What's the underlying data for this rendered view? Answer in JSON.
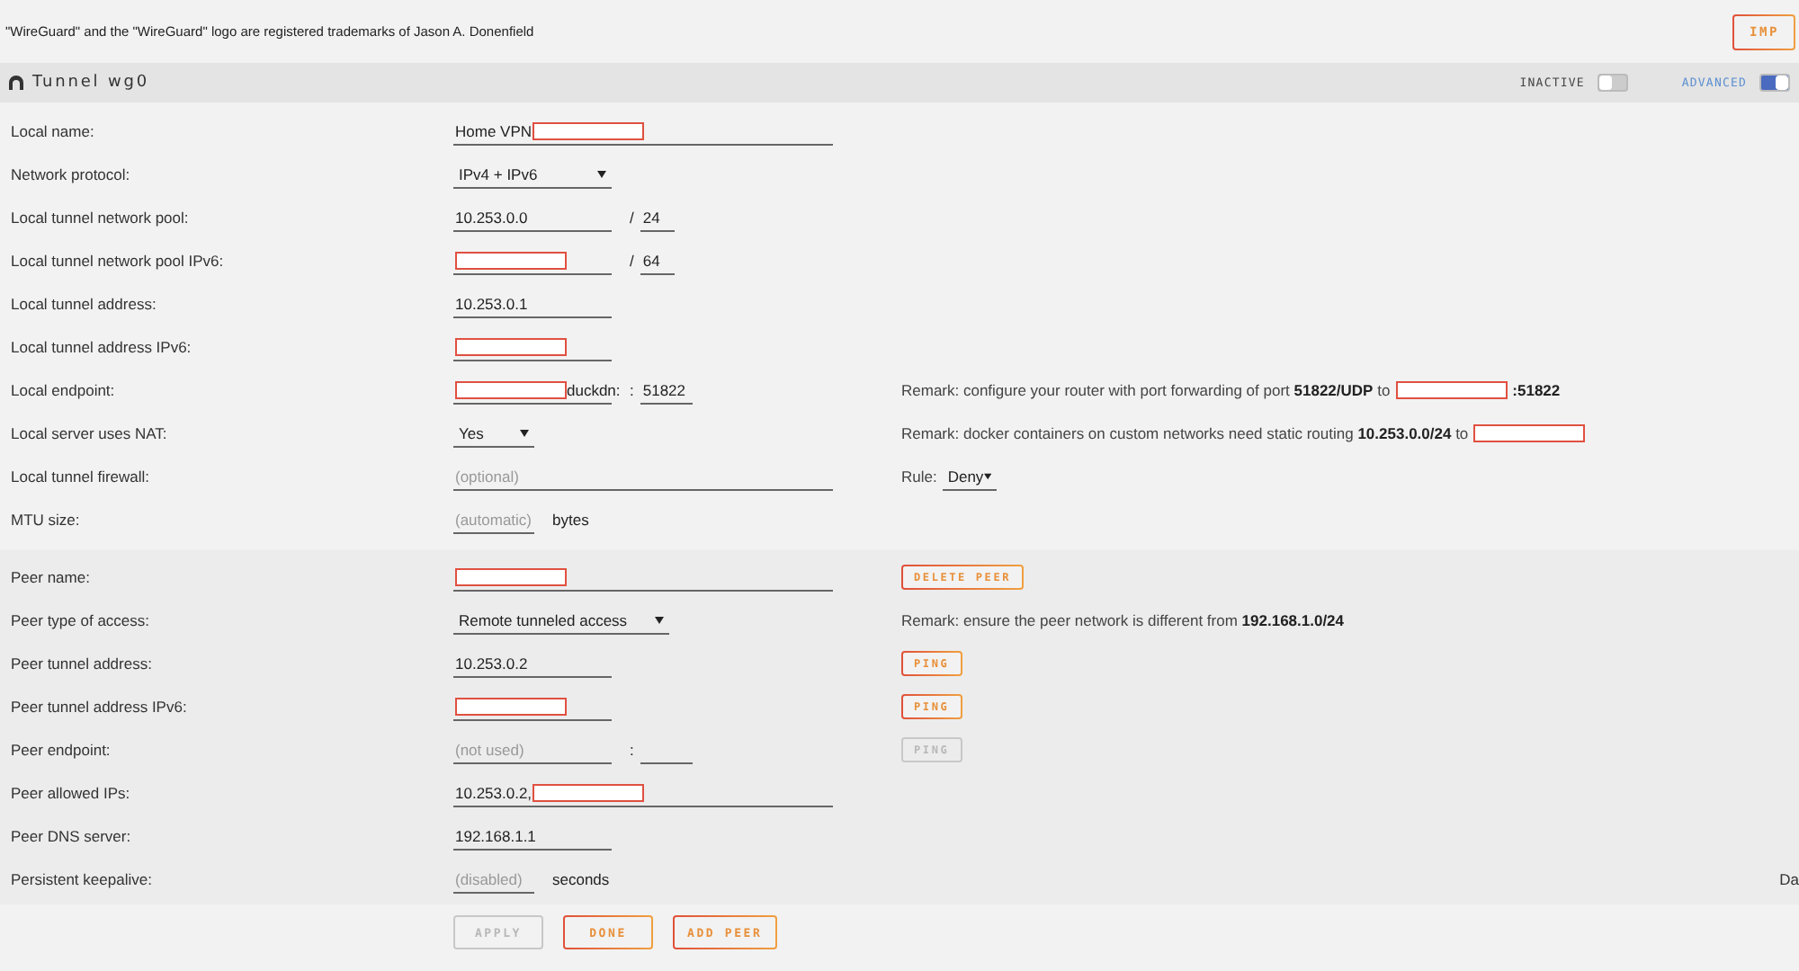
{
  "notice": "\"WireGuard\" and the \"WireGuard\" logo are registered trademarks of Jason A. Donenfield",
  "top_button": {
    "label": "IMP",
    "disabled": false
  },
  "tunnel": {
    "title": "Tunnel wg0",
    "toggles": [
      {
        "label": "INACTIVE",
        "on": false
      },
      {
        "label": "ADVANCED",
        "on": true
      }
    ]
  },
  "sections": [
    {
      "kind": "local",
      "rows": [
        {
          "label": "Local name:",
          "controls": [
            {
              "kind": "longfield",
              "value": "Home VPN",
              "redacted": true
            }
          ]
        },
        {
          "label": "Network protocol:",
          "controls": [
            {
              "kind": "select",
              "value": "IPv4 + IPv6"
            }
          ]
        },
        {
          "label": "Local tunnel network pool:",
          "controls": [
            {
              "kind": "field",
              "value": "10.253.0.0"
            },
            {
              "kind": "text",
              "text": "/"
            },
            {
              "kind": "tinyfield",
              "value": "24"
            }
          ]
        },
        {
          "label": "Local tunnel network pool IPv6:",
          "controls": [
            {
              "kind": "field",
              "redacted": true
            },
            {
              "kind": "text",
              "text": "/"
            },
            {
              "kind": "tinyfield",
              "value": "64"
            }
          ]
        },
        {
          "label": "Local tunnel address:",
          "controls": [
            {
              "kind": "field",
              "value": "10.253.0.1"
            }
          ]
        },
        {
          "label": "Local tunnel address IPv6:",
          "controls": [
            {
              "kind": "field",
              "redacted": true
            }
          ]
        },
        {
          "label": "Local endpoint:",
          "controls": [
            {
              "kind": "field",
              "redacted": true,
              "value_after": "duckdn:"
            },
            {
              "kind": "text",
              "text": ":"
            },
            {
              "kind": "portfield",
              "value": "51822"
            }
          ],
          "side": {
            "kind": "remark",
            "text": "Remark: configure your router with port forwarding of port **51822/UDP** to",
            "redacted": true,
            "after": ":51822"
          }
        },
        {
          "label": "Local server uses NAT:",
          "controls": [
            {
              "kind": "shortselect",
              "value": "Yes"
            }
          ],
          "side": {
            "kind": "remark",
            "text": "Remark: docker containers on custom networks need static routing **10.253.0.0/24** to",
            "redacted": true
          }
        },
        {
          "label": "Local tunnel firewall:",
          "controls": [
            {
              "kind": "longfield",
              "placeholder": "(optional)"
            }
          ],
          "side": {
            "kind": "rule",
            "label": "Rule:",
            "value": "Deny"
          }
        },
        {
          "label": "MTU size:",
          "controls": [
            {
              "kind": "shortfield",
              "placeholder": "(automatic)"
            },
            {
              "kind": "text",
              "text": "bytes"
            }
          ]
        }
      ]
    },
    {
      "kind": "peer",
      "rows": [
        {
          "label": "Peer name:",
          "controls": [
            {
              "kind": "longfield",
              "redacted": true
            }
          ],
          "side": {
            "kind": "button",
            "label": "DELETE PEER",
            "disabled": false
          }
        },
        {
          "label": "Peer type of access:",
          "controls": [
            {
              "kind": "longselect",
              "value": "Remote tunneled access"
            }
          ],
          "side": {
            "kind": "remark",
            "text": "Remark: ensure the peer network is different from **192.168.1.0/24**"
          }
        },
        {
          "label": "Peer tunnel address:",
          "controls": [
            {
              "kind": "field",
              "value": "10.253.0.2"
            }
          ],
          "side": {
            "kind": "button",
            "label": "PING",
            "disabled": false
          }
        },
        {
          "label": "Peer tunnel address IPv6:",
          "controls": [
            {
              "kind": "field",
              "redacted": true
            }
          ],
          "side": {
            "kind": "button",
            "label": "PING",
            "disabled": false
          }
        },
        {
          "label": "Peer endpoint:",
          "controls": [
            {
              "kind": "field",
              "placeholder": "(not used)"
            },
            {
              "kind": "text",
              "text": ":"
            },
            {
              "kind": "portfield"
            }
          ],
          "side": {
            "kind": "button",
            "label": "PING",
            "disabled": true
          }
        },
        {
          "label": "Peer allowed IPs:",
          "controls": [
            {
              "kind": "longfield",
              "value": "10.253.0.2,",
              "redacted": true
            }
          ]
        },
        {
          "label": "Peer DNS server:",
          "controls": [
            {
              "kind": "field",
              "value": "192.168.1.1"
            }
          ]
        },
        {
          "label": "Persistent keepalive:",
          "controls": [
            {
              "kind": "shortfield",
              "placeholder": "(disabled)"
            },
            {
              "kind": "text",
              "text": "seconds"
            }
          ],
          "edge": "Da"
        }
      ]
    }
  ],
  "footer_buttons": [
    {
      "label": "APPLY",
      "disabled": true
    },
    {
      "label": "DONE",
      "disabled": false
    },
    {
      "label": "ADD PEER",
      "disabled": false
    }
  ]
}
